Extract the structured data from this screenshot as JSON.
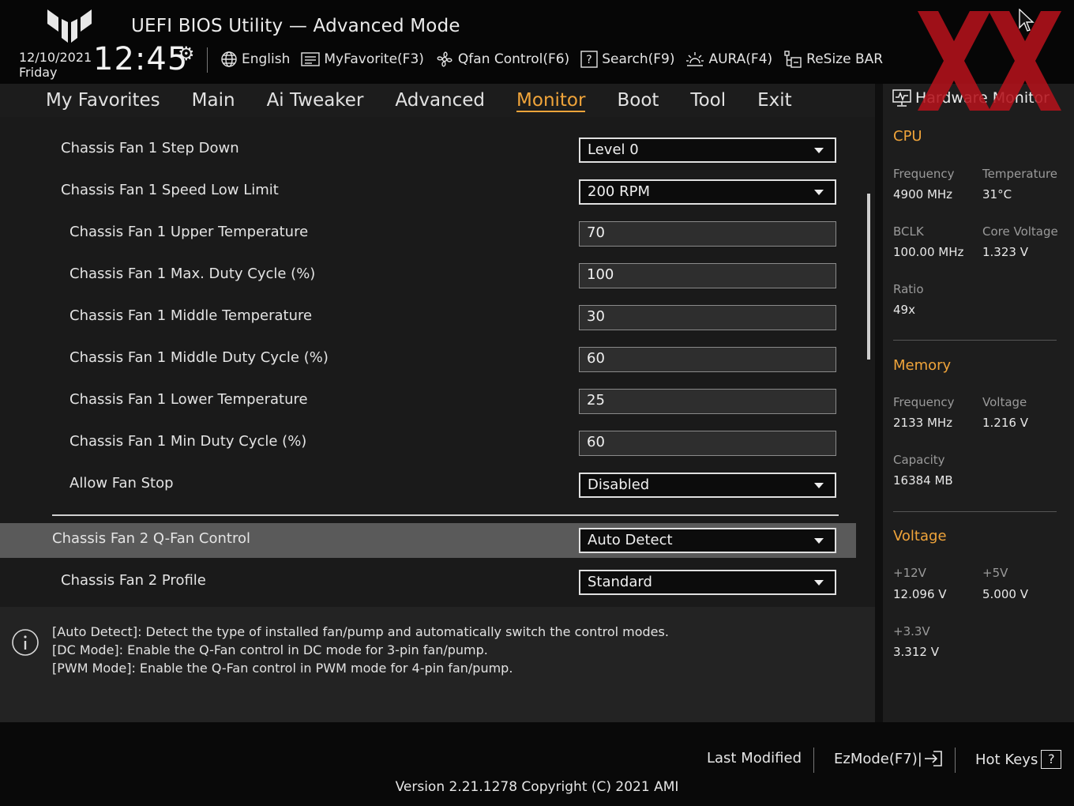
{
  "header": {
    "title": "UEFI BIOS Utility — Advanced Mode",
    "date": "12/10/2021",
    "day": "Friday",
    "time": "12:45",
    "toolbar": [
      {
        "label": "English",
        "icon": "globe-icon"
      },
      {
        "label": "MyFavorite(F3)",
        "icon": "favorite-list-icon"
      },
      {
        "label": "Qfan Control(F6)",
        "icon": "fan-icon"
      },
      {
        "label": "Search(F9)",
        "icon": "search-help-icon"
      },
      {
        "label": "AURA(F4)",
        "icon": "aura-icon"
      },
      {
        "label": "ReSize BAR",
        "icon": "resize-bar-icon"
      }
    ]
  },
  "nav": {
    "tabs": [
      "My Favorites",
      "Main",
      "Ai Tweaker",
      "Advanced",
      "Monitor",
      "Boot",
      "Tool",
      "Exit"
    ],
    "active": "Monitor"
  },
  "settings": [
    {
      "label": "Chassis Fan 1 Step Down",
      "value": "Level 0",
      "type": "dropdown",
      "indent": 0
    },
    {
      "label": "Chassis Fan 1 Speed Low Limit",
      "value": "200 RPM",
      "type": "dropdown",
      "indent": 0
    },
    {
      "label": "Chassis Fan 1 Upper Temperature",
      "value": "70",
      "type": "number",
      "indent": 1
    },
    {
      "label": "Chassis Fan 1 Max. Duty Cycle (%)",
      "value": "100",
      "type": "number",
      "indent": 1
    },
    {
      "label": "Chassis Fan 1 Middle Temperature",
      "value": "30",
      "type": "number",
      "indent": 1
    },
    {
      "label": "Chassis Fan 1 Middle Duty Cycle (%)",
      "value": "60",
      "type": "number",
      "indent": 1
    },
    {
      "label": "Chassis Fan 1 Lower Temperature",
      "value": "25",
      "type": "number",
      "indent": 1
    },
    {
      "label": "Chassis Fan 1 Min Duty Cycle (%)",
      "value": "60",
      "type": "number",
      "indent": 1
    },
    {
      "label": "Allow Fan Stop",
      "value": "Disabled",
      "type": "dropdown",
      "indent": 1
    },
    {
      "label": "Chassis Fan 2 Q-Fan Control",
      "value": "Auto Detect",
      "type": "dropdown",
      "indent": -1,
      "selected": true
    },
    {
      "label": "Chassis Fan 2 Profile",
      "value": "Standard",
      "type": "dropdown",
      "indent": 0
    }
  ],
  "help": {
    "lines": [
      "[Auto Detect]: Detect the type of installed fan/pump and automatically switch the control modes.",
      "[DC Mode]: Enable the Q-Fan control in DC mode for 3-pin fan/pump.",
      "[PWM Mode]: Enable the Q-Fan control in PWM mode for 4-pin fan/pump."
    ]
  },
  "hw": {
    "title": "Hardware Monitor",
    "cpu": {
      "heading": "CPU",
      "frequency_label": "Frequency",
      "frequency": "4900 MHz",
      "temperature_label": "Temperature",
      "temperature": "31°C",
      "bclk_label": "BCLK",
      "bclk": "100.00 MHz",
      "core_voltage_label": "Core Voltage",
      "core_voltage": "1.323 V",
      "ratio_label": "Ratio",
      "ratio": "49x"
    },
    "memory": {
      "heading": "Memory",
      "frequency_label": "Frequency",
      "frequency": "2133 MHz",
      "voltage_label": "Voltage",
      "voltage": "1.216 V",
      "capacity_label": "Capacity",
      "capacity": "16384 MB"
    },
    "voltage": {
      "heading": "Voltage",
      "v12_label": "+12V",
      "v12": "12.096 V",
      "v5_label": "+5V",
      "v5": "5.000 V",
      "v33_label": "+3.3V",
      "v33": "3.312 V"
    }
  },
  "footer": {
    "last_modified": "Last Modified",
    "ezmode": "EzMode(F7)|",
    "hotkeys": "Hot Keys",
    "hotkeys_badge": "?",
    "version": "Version 2.21.1278 Copyright (C) 2021 AMI"
  },
  "colors": {
    "accent": "#f0a43a",
    "watermark": "#b3121b"
  }
}
